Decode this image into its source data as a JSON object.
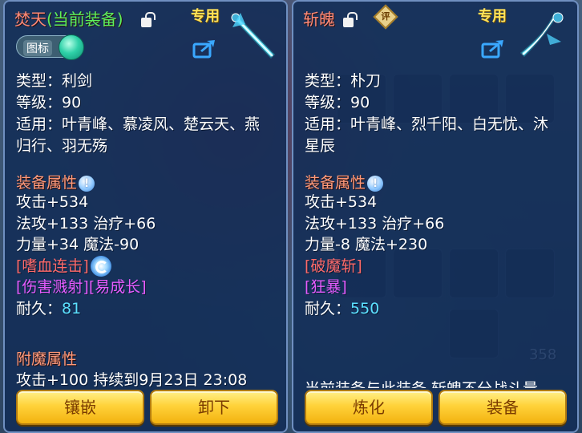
{
  "left_panel": {
    "title": "焚天",
    "title_status": "(当前装备)",
    "special_label": "专用",
    "toggle_label": "图标",
    "info": {
      "type": "类型：利剑",
      "level": "等级：90",
      "applicable_line1": "适用：叶青峰、慕凌风、楚云天、燕",
      "applicable_line2": "归行、羽无殇"
    },
    "attr_header": "装备属性",
    "stats": [
      "攻击+534",
      "法攻+133 治疗+66",
      "力量+34 魔法-90"
    ],
    "skills_red": "[嗜血连击]",
    "skills_purple": "[伤害溅射][易成长]",
    "durability_label": "耐久：",
    "durability_value": "81",
    "enchant_header": "附魔属性",
    "enchant_line": "攻击+100 持续到9月23日 23:08",
    "buttons": {
      "inlay": "镶嵌",
      "unequip": "卸下"
    }
  },
  "right_panel": {
    "title": "斩魄",
    "eval_badge": "评",
    "special_label": "专用",
    "info": {
      "type": "类型：朴刀",
      "level": "等级：90",
      "applicable_line1": "适用：叶青峰、烈千阳、白无忧、沐",
      "applicable_line2": "星辰"
    },
    "attr_header": "装备属性",
    "stats": [
      "攻击+534",
      "法攻+133 治疗+66",
      "力量-8 魔法+230"
    ],
    "skills_red": "[破魔斩]",
    "skills_purple": "[狂暴]",
    "durability_label": "耐久：",
    "durability_value": "550",
    "cut_text": "当前装备与此装备 斩魄不分战斗量",
    "buttons": {
      "refine": "炼化",
      "equip": "装备"
    }
  },
  "background": {
    "item_count": "358"
  },
  "colors": {
    "title_red": "#ff8b78",
    "current_green": "#5cf05c",
    "special_yellow": "#ffe25a",
    "skill_red": "#ff6a6a",
    "skill_purple": "#e65cff",
    "durability_cyan": "#5ce0ff",
    "button_gold": "#ffd23a"
  },
  "icons": [
    "lock-icon",
    "share-icon",
    "help-icon",
    "spin-icon",
    "weapon-sword-icon",
    "weapon-blade-icon",
    "eval-badge-icon"
  ]
}
